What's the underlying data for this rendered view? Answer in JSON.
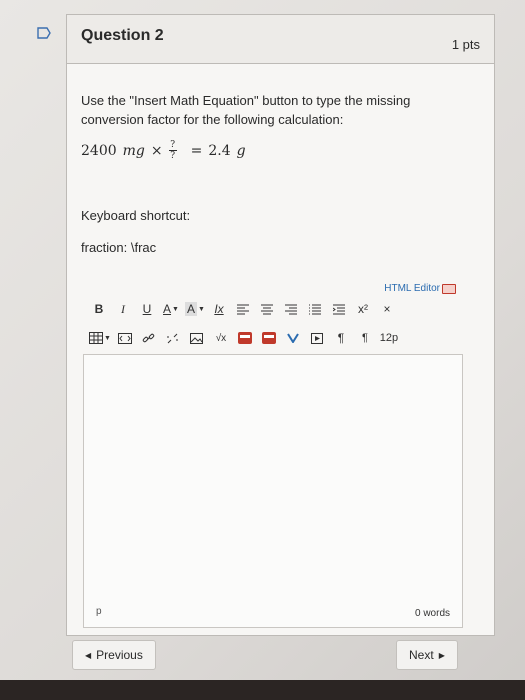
{
  "question": {
    "title": "Question 2",
    "points": "1 pts",
    "prompt": "Use the \"Insert Math Equation\" button to type the missing conversion factor for the following calculation:",
    "equation": {
      "left_value": "2400",
      "left_unit": "mg",
      "operator": "×",
      "frac_num": "?",
      "frac_den": "?",
      "equals": "=",
      "right_value": "2.4",
      "right_unit": "g"
    },
    "shortcut_label": "Keyboard shortcut:",
    "shortcut_value": "fraction: \\frac"
  },
  "editor": {
    "html_editor_label": "HTML Editor",
    "toolbar_row1": [
      "B",
      "I",
      "U",
      "A",
      "A",
      "Ix",
      "x²",
      "×"
    ],
    "toolbar_row2_text": [
      "√x",
      "¶",
      "12p"
    ],
    "path": "p",
    "word_count": "0 words"
  },
  "nav": {
    "previous_label": "Previous",
    "next_label": "Next"
  },
  "colors": {
    "link_blue": "#2b6cb0",
    "flag_blue": "#3b6fb0"
  }
}
